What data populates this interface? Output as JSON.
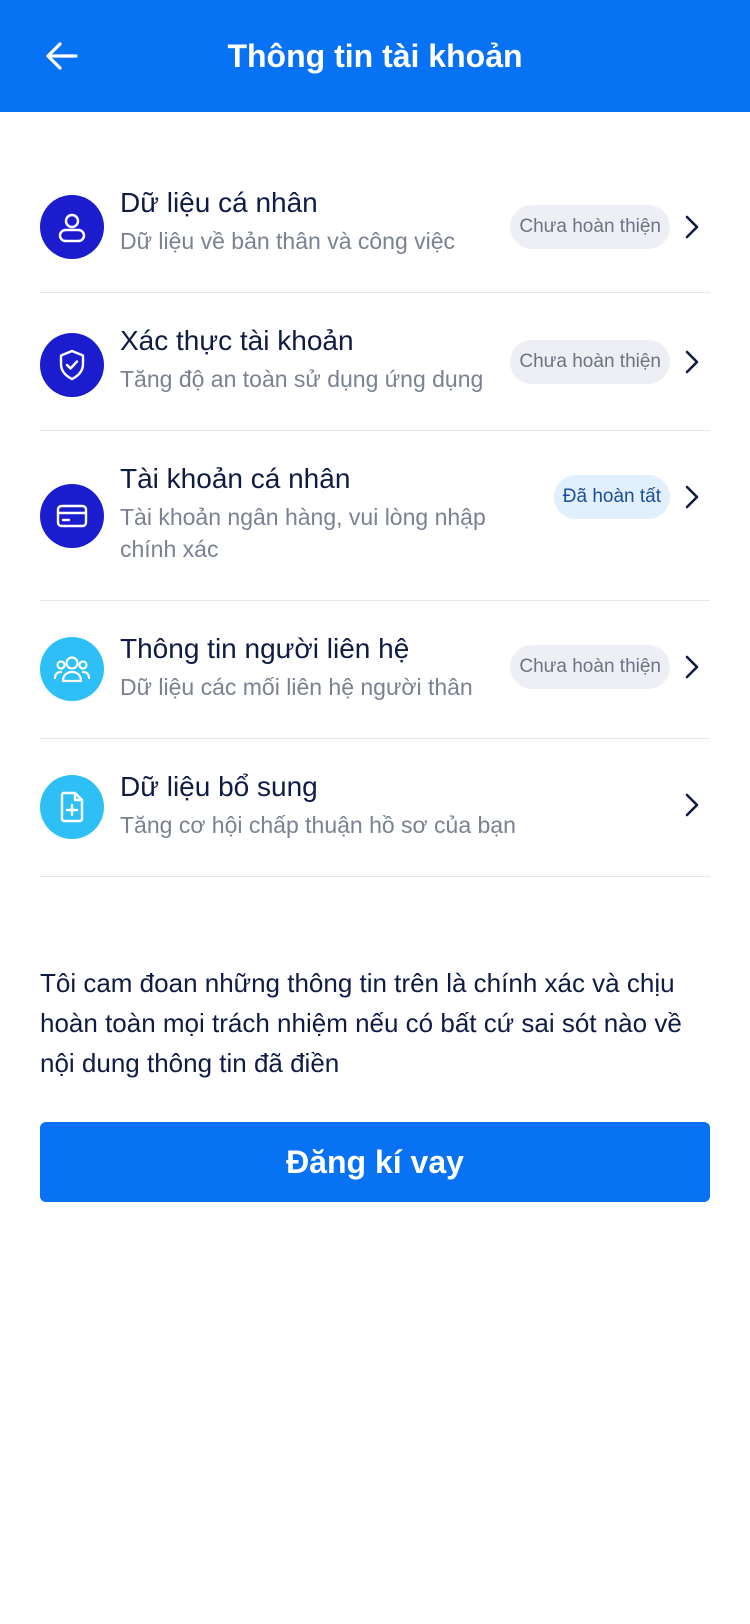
{
  "header": {
    "title": "Thông tin tài khoản",
    "back_icon": "arrow-left-icon",
    "background": "#0872F5"
  },
  "items": [
    {
      "title": "Dữ liệu cá nhân",
      "subtitle": "Dữ liệu về bản thân và công việc",
      "status": "Chưa hoàn thiện",
      "icon": "user-icon"
    },
    {
      "title": "Xác thực tài khoản",
      "subtitle": "Tăng độ an toàn sử dụng ứng dụng",
      "status": "Chưa hoàn thiện",
      "icon": "shield-check-icon"
    },
    {
      "title": "Tài khoản cá nhân",
      "subtitle": "Tài khoản ngân hàng, vui lòng nhập chính xác",
      "status": "Đã hoàn tất",
      "icon": "credit-card-icon"
    },
    {
      "title": "Thông tin người liên hệ",
      "subtitle": "Dữ liệu các mối liên hệ người thân",
      "status": "Chưa hoàn thiện",
      "icon": "contacts-group-icon"
    },
    {
      "title": "Dữ liệu bổ sung",
      "subtitle": "Tăng cơ hội chấp thuận hồ sơ của bạn",
      "status": "",
      "icon": "document-add-icon"
    }
  ],
  "declaration": "Tôi cam đoan những thông tin trên là chính xác và chịu hoàn toàn mọi trách nhiệm nếu có bất cứ sai sót nào về nội dung thông tin đã điền",
  "submit_label": "Đăng kí vay",
  "colors": {
    "primary": "#0872F5",
    "icon_dark": "#1C1CCF",
    "icon_light": "#2DBFF5",
    "badge_pending_bg": "#EEEFF4",
    "badge_done_bg": "#E2EFFD"
  }
}
